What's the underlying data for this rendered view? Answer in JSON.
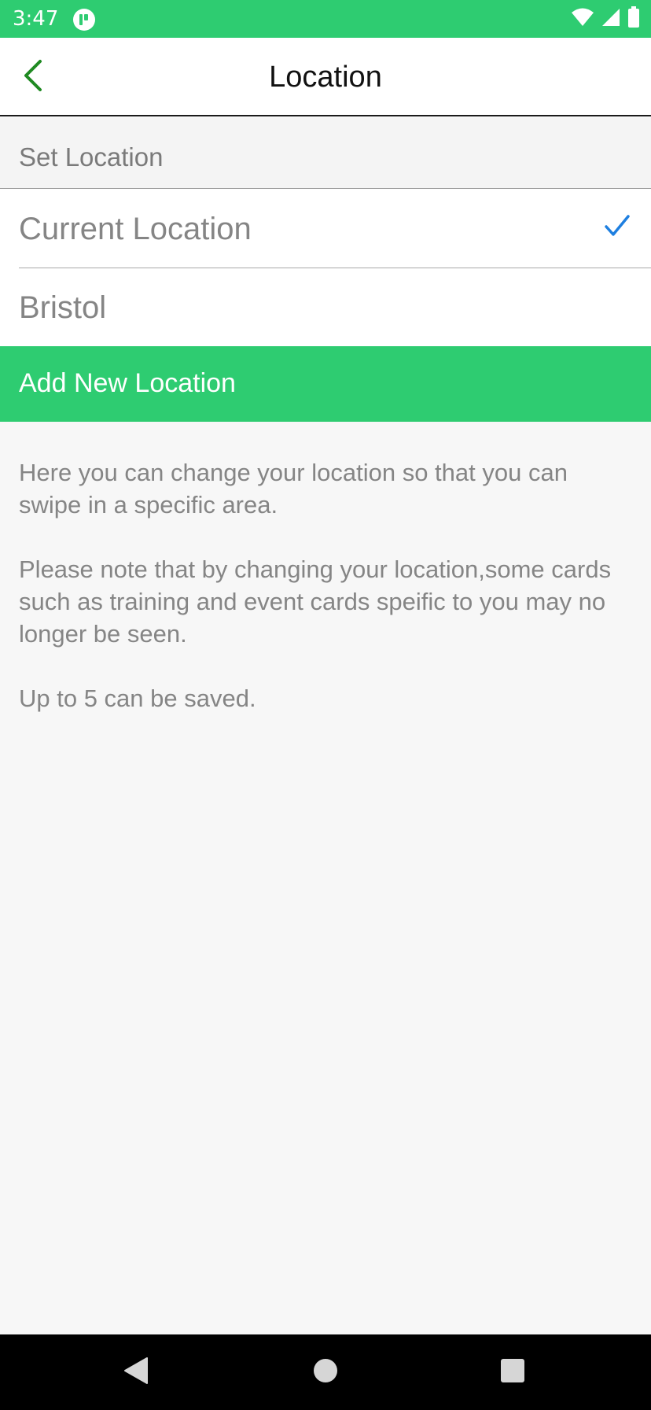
{
  "status_bar": {
    "time": "3:47",
    "background_color": "#2ecc71",
    "icons": [
      "app-notification-icon",
      "wifi-icon",
      "cell-signal-icon",
      "battery-icon"
    ]
  },
  "header": {
    "title": "Location",
    "back_icon": "chevron-left-icon",
    "accent_color": "#1f8a22"
  },
  "section": {
    "label": "Set Location"
  },
  "locations": [
    {
      "label": "Current Location",
      "selected": true
    },
    {
      "label": "Bristol",
      "selected": false
    }
  ],
  "add_location": {
    "label": "Add New Location",
    "background_color": "#2ecc71"
  },
  "info": {
    "paragraph_1": "Here you can change your location so that you can swipe in a specific area.",
    "paragraph_2": "Please note that by changing your location,some cards such as training and event cards speific to you may no longer be seen.",
    "paragraph_3": "Up to 5 can be saved."
  },
  "nav_bar": {
    "icons": [
      "back-triangle-icon",
      "home-circle-icon",
      "recents-square-icon"
    ]
  },
  "check_color": "#1e7fe0"
}
